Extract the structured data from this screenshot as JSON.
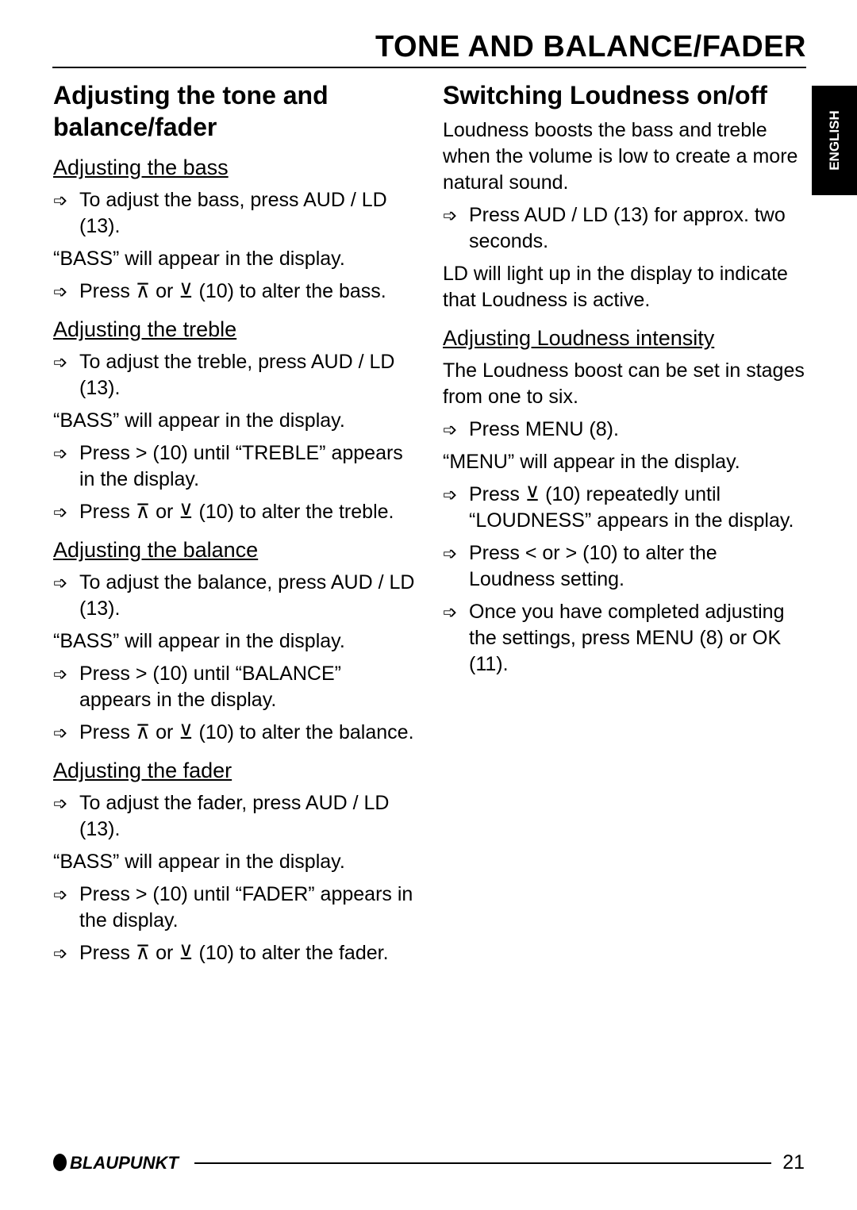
{
  "page": {
    "title": "TONE AND BALANCE/FADER",
    "language_tab": "ENGLISH",
    "brand": "BLAUPUNKT",
    "page_number": "21"
  },
  "left": {
    "heading": "Adjusting the tone and balance/fader",
    "bass": {
      "heading": "Adjusting the bass",
      "s1": "To adjust the bass, press AUD / LD (13).",
      "p1": "“BASS” will appear in the display.",
      "s2": "Press ⊼ or ⊻ (10) to alter the bass."
    },
    "treble": {
      "heading": "Adjusting the treble",
      "s1": "To adjust the treble, press AUD / LD (13).",
      "p1": "“BASS” will appear in the display.",
      "s2": "Press > (10) until “TREBLE” appears in the display.",
      "s3": "Press ⊼ or ⊻ (10) to alter the treble."
    },
    "balance": {
      "heading": "Adjusting the balance",
      "s1": "To adjust the balance, press AUD / LD (13).",
      "p1": "“BASS” will appear in the display.",
      "s2": "Press > (10) until “BALANCE” appears in the display.",
      "s3": "Press ⊼ or ⊻ (10) to alter the balance."
    },
    "fader": {
      "heading": "Adjusting the fader",
      "s1": "To adjust the fader, press AUD / LD (13).",
      "p1": "“BASS” will appear in the display.",
      "s2": "Press > (10) until “FADER” appears in the display.",
      "s3": "Press ⊼ or ⊻ (10) to alter the fader."
    }
  },
  "right": {
    "heading": "Switching Loudness on/off",
    "p1": "Loudness boosts the bass and treble when the volume is low to create a more natural sound.",
    "s1": "Press AUD / LD (13) for approx. two seconds.",
    "p2": "LD will light up in the display to indicate that Loudness is active.",
    "intensity": {
      "heading": "Adjusting Loudness intensity",
      "p1": "The Loudness boost can be set in stages from one to six.",
      "s1": "Press MENU (8).",
      "p2": "“MENU” will appear in the display.",
      "s2": "Press ⊻ (10) repeatedly until “LOUDNESS” appears in the display.",
      "s3": "Press < or > (10) to alter the Loudness setting.",
      "s4": "Once you have completed adjusting the settings, press MENU (8) or OK (11)."
    }
  }
}
